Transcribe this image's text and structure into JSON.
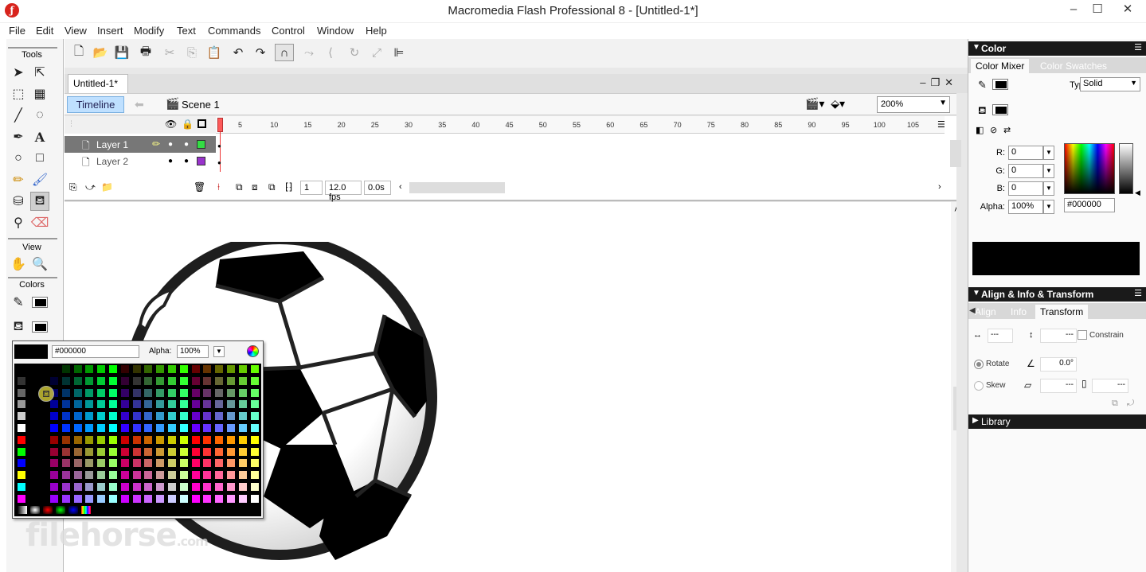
{
  "window": {
    "title": "Macromedia Flash Professional 8 - [Untitled-1*]",
    "minimize": "–",
    "maximize": "☐",
    "close": "✕"
  },
  "menu": [
    "File",
    "Edit",
    "View",
    "Insert",
    "Modify",
    "Text",
    "Commands",
    "Control",
    "Window",
    "Help"
  ],
  "tools": {
    "section_tools": "Tools",
    "section_view": "View",
    "section_colors": "Colors"
  },
  "document": {
    "tab_label": "Untitled-1*",
    "timeline_button": "Timeline",
    "scene_label": "Scene 1",
    "zoom": "200%"
  },
  "timeline": {
    "ruler_ticks": [
      "5",
      "10",
      "15",
      "20",
      "25",
      "30",
      "35",
      "40",
      "45",
      "50",
      "55",
      "60",
      "65",
      "70",
      "75",
      "80",
      "85",
      "90",
      "95",
      "100",
      "105"
    ],
    "layers": [
      {
        "name": "Layer 1",
        "color": "#33dd44",
        "selected": true
      },
      {
        "name": "Layer 2",
        "color": "#9933cc",
        "selected": false
      }
    ],
    "current_frame": "1",
    "frame_rate": "12.0 fps",
    "elapsed": "0.0s"
  },
  "swatch_popup": {
    "hex": "#000000",
    "alpha_label": "Alpha:",
    "alpha_value": "100%"
  },
  "watermark": {
    "main": "filehorse",
    "suffix": ".com"
  },
  "color_panel": {
    "title": "Color",
    "tab_mixer": "Color Mixer",
    "tab_swatches": "Color Swatches",
    "type_label": "Type:",
    "type_value": "Solid",
    "r_label": "R:",
    "r_value": "0",
    "g_label": "G:",
    "g_value": "0",
    "b_label": "B:",
    "b_value": "0",
    "alpha_label": "Alpha:",
    "alpha_value": "100%",
    "hex_value": "#000000"
  },
  "align_panel": {
    "title": "Align & Info & Transform",
    "tab_align": "Align",
    "tab_info": "Info",
    "tab_transform": "Transform",
    "width_value": "---",
    "height_value": "---",
    "constrain_label": "Constrain",
    "rotate_label": "Rotate",
    "rotate_value": "0.0°",
    "skew_label": "Skew",
    "skew_h_value": "---",
    "skew_v_value": "---"
  },
  "library_panel": {
    "title": "Library"
  }
}
